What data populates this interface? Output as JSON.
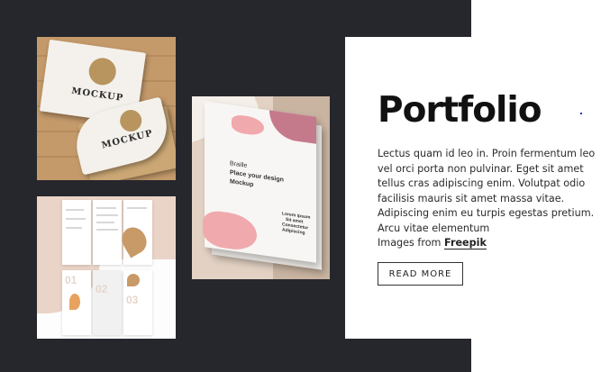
{
  "portfolio": {
    "title": "Portfolio",
    "description": "Lectus quam id leo in. Proin fermentum leo vel orci porta non pulvinar. Eget sit amet tellus cras adipiscing enim. Volutpat odio facilisis mauris sit amet massa vitae. Adipiscing enim eu turpis egestas pretium. Arcu vitae elementum",
    "credit_prefix": "Images from ",
    "credit_link": "Freepik",
    "read_more": "READ MORE"
  },
  "gallery": {
    "business_card": {
      "mockup_word": "MOCKUP"
    },
    "brochure": {
      "numbers": [
        "01",
        "02",
        "03"
      ]
    },
    "braille": {
      "title_lines": [
        "Braille",
        "Place your design",
        "Mockup"
      ],
      "footer_lines": [
        "Lorem ipsum",
        "Sit amet",
        "Consectetur",
        "Adipiscing"
      ]
    }
  },
  "colors": {
    "dark_background": "#26272d",
    "card_background": "#ffffff",
    "accent_pink": "#f0a9ad",
    "kraft": "#caa774"
  }
}
